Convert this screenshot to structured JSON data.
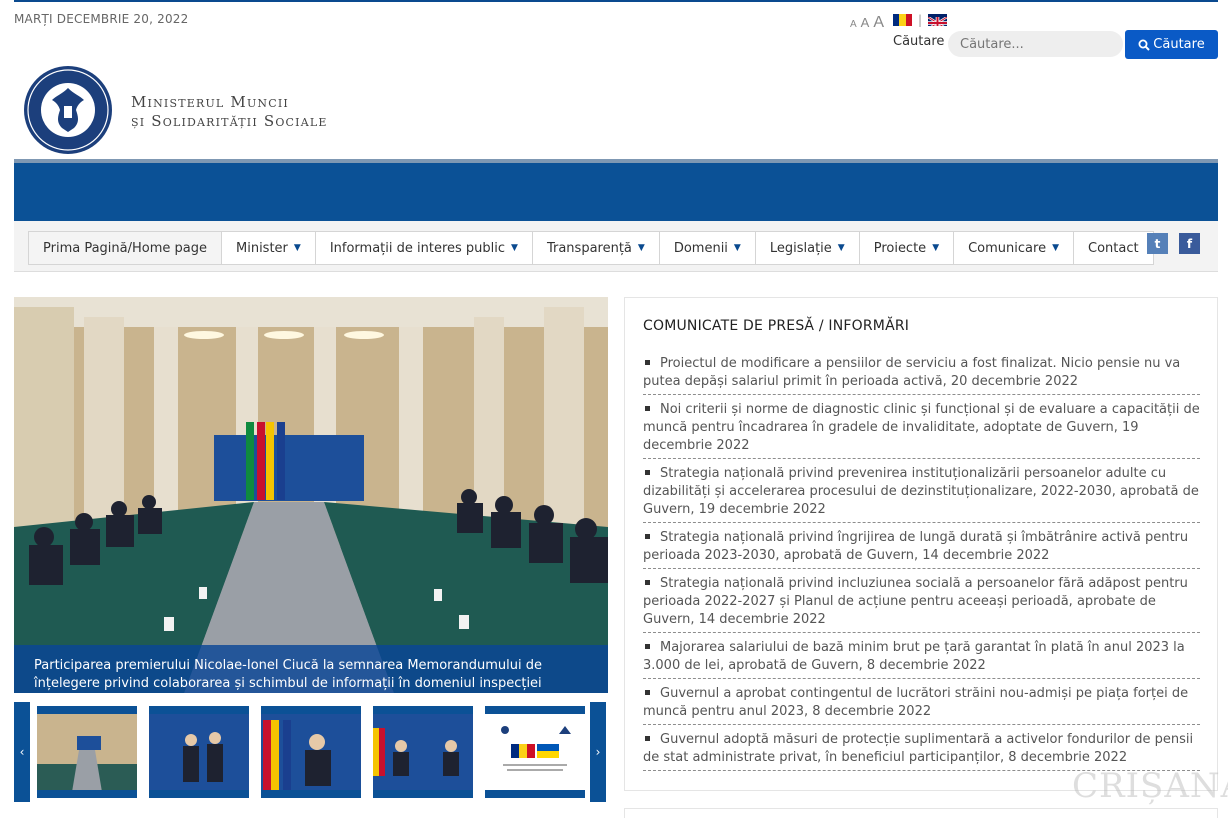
{
  "header": {
    "date": "MARȚI DECEMBRIE 20, 2022",
    "font_size_labels": [
      "A",
      "A",
      "A"
    ],
    "flag_separator": "|",
    "search": {
      "label": "Căutare",
      "placeholder": "Căutare...",
      "button_label": "Căutare"
    },
    "ministry": {
      "line1": "Ministerul Muncii",
      "line2": "și Solidarității Sociale"
    }
  },
  "nav": {
    "items": [
      {
        "label": "Prima Pagină/Home page",
        "has_dropdown": false
      },
      {
        "label": "Minister",
        "has_dropdown": true
      },
      {
        "label": "Informații de interes public",
        "has_dropdown": true
      },
      {
        "label": "Transparență",
        "has_dropdown": true
      },
      {
        "label": "Domenii",
        "has_dropdown": true
      },
      {
        "label": "Legislație",
        "has_dropdown": true
      },
      {
        "label": "Proiecte",
        "has_dropdown": true
      },
      {
        "label": "Comunicare",
        "has_dropdown": true
      },
      {
        "label": "Contact",
        "has_dropdown": false
      }
    ],
    "caret": "▼",
    "social": {
      "twitter": "t",
      "facebook": "f"
    }
  },
  "slider": {
    "caption": "Participarea premierului Nicolae-Ionel Ciucă la semnarea Memorandumului de înțelegere privind colaborarea și schimbul de informații în domeniul inspecției muncii",
    "prev_arrow": "‹",
    "next_arrow": "›"
  },
  "news": {
    "title": "COMUNICATE DE PRESĂ / INFORMĂRI",
    "items": [
      "Proiectul de modificare a pensiilor de serviciu a fost finalizat. Nicio pensie nu va putea depăși salariul primit în perioada activă, 20 decembrie 2022",
      "Noi criterii și norme de diagnostic clinic și funcțional și de evaluare a capacității de muncă pentru încadrarea în gradele de invaliditate, adoptate de Guvern, 19 decembrie 2022",
      "Strategia națională privind prevenirea instituționalizării persoanelor adulte cu dizabilități și accelerarea procesului de dezinstituționalizare, 2022-2030, aprobată de Guvern, 19 decembrie 2022",
      "Strategia națională privind îngrijirea de lungă durată și îmbătrânire activă pentru perioada 2023-2030, aprobată de Guvern, 14 decembrie 2022",
      "Strategia națională privind incluziunea socială a persoanelor fără adăpost pentru perioada 2022-2027 și Planul de acțiune pentru aceeași perioadă, aprobate de Guvern, 14 decembrie 2022",
      "Majorarea salariului de bază minim brut pe țară garantat în plată în anul 2023 la 3.000 de lei, aprobată de Guvern, 8 decembrie 2022",
      "Guvernul a aprobat contingentul de lucrători străini nou-admiși pe piața forței de muncă pentru anul 2023, 8 decembrie 2022",
      "Guvernul adoptă măsuri de protecție suplimentară a activelor fondurilor de pensii de stat administrate privat, în beneficiul participanților, 8 decembrie 2022"
    ]
  },
  "watermark": "CRIȘANA",
  "colors": {
    "brand_blue": "#0b5196",
    "search_button": "#0a5ac6",
    "flag_ro": [
      "#002b7f",
      "#fcd116",
      "#ce1126"
    ]
  }
}
